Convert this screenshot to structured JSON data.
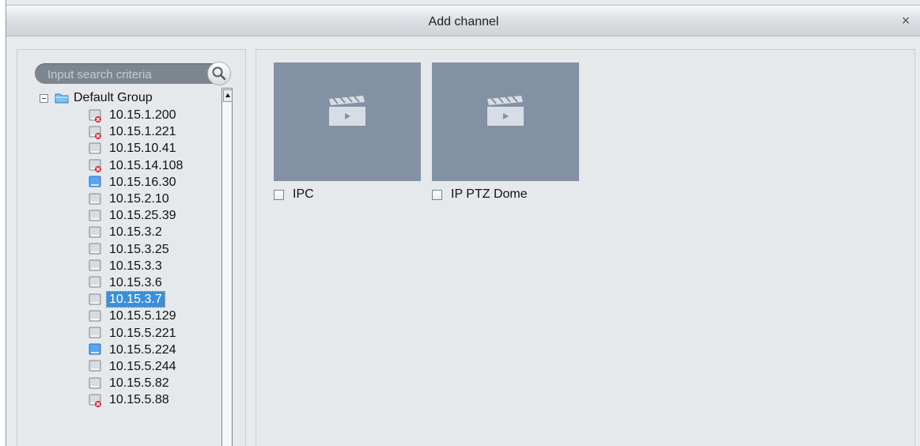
{
  "dialog": {
    "title": "Add channel",
    "close_icon": "×"
  },
  "search": {
    "placeholder": "Input search criteria",
    "icon": "search-icon"
  },
  "tree": {
    "root_label": "Default Group",
    "items": [
      {
        "label": "10.15.1.200",
        "state": "offline",
        "icon": "device-icon"
      },
      {
        "label": "10.15.1.221",
        "state": "offline",
        "icon": "device-icon"
      },
      {
        "label": "10.15.10.41",
        "state": "normal",
        "icon": "device-icon"
      },
      {
        "label": "10.15.14.108",
        "state": "offline",
        "icon": "device-icon"
      },
      {
        "label": "10.15.16.30",
        "state": "online",
        "icon": "device-icon"
      },
      {
        "label": "10.15.2.10",
        "state": "normal",
        "icon": "device-icon"
      },
      {
        "label": "10.15.25.39",
        "state": "normal",
        "icon": "device-icon"
      },
      {
        "label": "10.15.3.2",
        "state": "normal",
        "icon": "device-icon"
      },
      {
        "label": "10.15.3.25",
        "state": "normal",
        "icon": "device-icon"
      },
      {
        "label": "10.15.3.3",
        "state": "normal",
        "icon": "device-icon"
      },
      {
        "label": "10.15.3.6",
        "state": "normal",
        "icon": "device-icon"
      },
      {
        "label": "10.15.3.7",
        "state": "selected",
        "icon": "device-icon"
      },
      {
        "label": "10.15.5.129",
        "state": "normal",
        "icon": "device-icon"
      },
      {
        "label": "10.15.5.221",
        "state": "normal",
        "icon": "device-icon"
      },
      {
        "label": "10.15.5.224",
        "state": "online",
        "icon": "device-icon"
      },
      {
        "label": "10.15.5.244",
        "state": "normal",
        "icon": "device-icon"
      },
      {
        "label": "10.15.5.82",
        "state": "normal",
        "icon": "device-icon"
      },
      {
        "label": "10.15.5.88",
        "state": "offline",
        "icon": "device-icon"
      }
    ]
  },
  "channels": [
    {
      "label": "IPC",
      "checked": false,
      "icon": "video-clapper-icon"
    },
    {
      "label": "IP PTZ Dome",
      "checked": false,
      "icon": "video-clapper-icon"
    }
  ],
  "colors": {
    "selected": "#3a8fd8",
    "thumbnail": "#8391a4",
    "offline": "#d4232f"
  }
}
